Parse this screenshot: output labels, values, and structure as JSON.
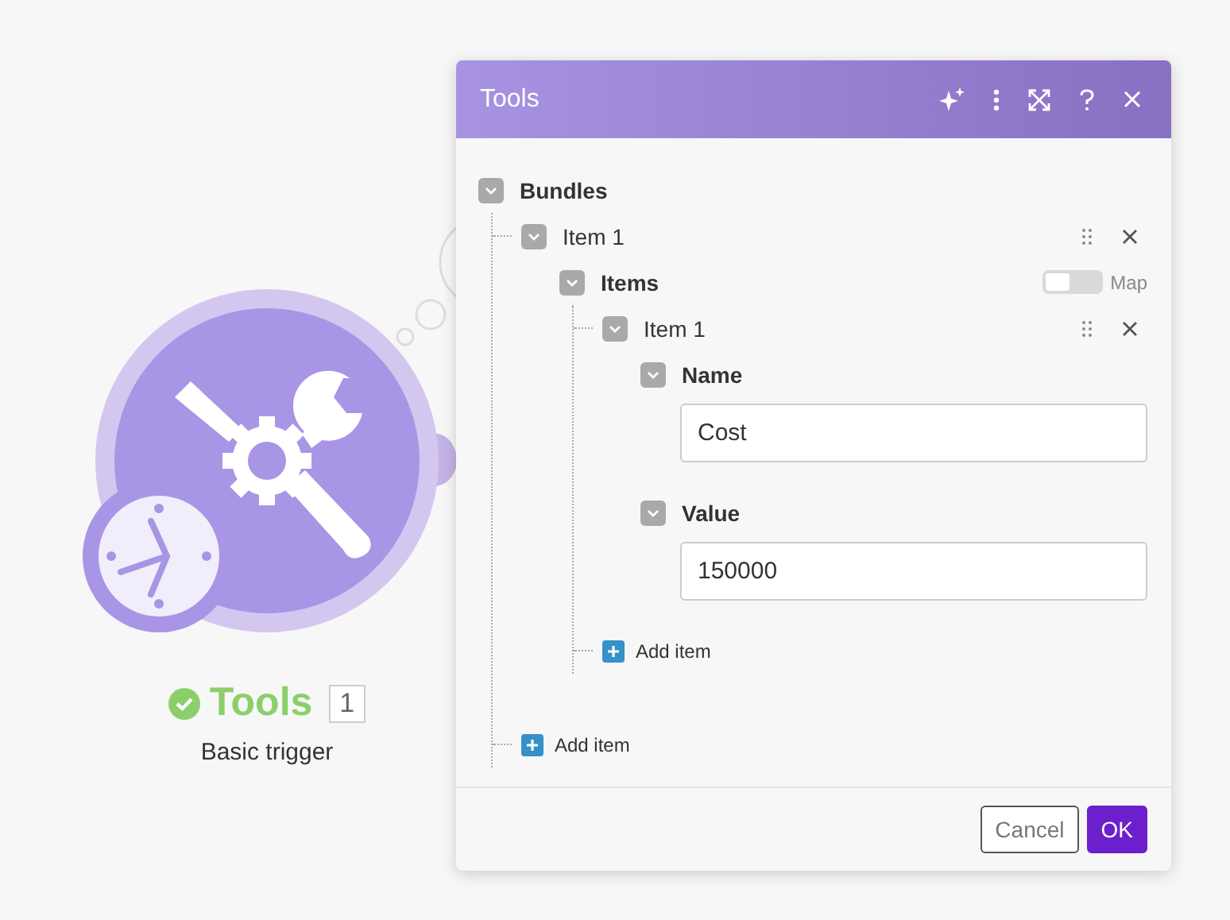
{
  "module": {
    "name": "Tools",
    "success": true,
    "count": "1",
    "subtitle": "Basic trigger"
  },
  "dialog": {
    "title": "Tools",
    "tree": {
      "label": "Bundles",
      "expanded": true,
      "items": [
        {
          "label": "Item 1",
          "expanded": true,
          "fields": [
            {
              "kind": "array",
              "label": "Items",
              "expanded": true,
              "map_toggle": {
                "label": "Map",
                "on": false
              },
              "add_label": "Add item",
              "items": [
                {
                  "label": "Item 1",
                  "expanded": true,
                  "fields": [
                    {
                      "kind": "text",
                      "label": "Name",
                      "expanded": true,
                      "value": "Cost"
                    },
                    {
                      "kind": "text",
                      "label": "Value",
                      "expanded": true,
                      "value": "150000"
                    }
                  ]
                }
              ]
            }
          ]
        }
      ],
      "add_label": "Add item"
    },
    "buttons": [
      {
        "kind": "secondary",
        "label": "Cancel"
      },
      {
        "kind": "primary",
        "label": "OK"
      }
    ]
  }
}
